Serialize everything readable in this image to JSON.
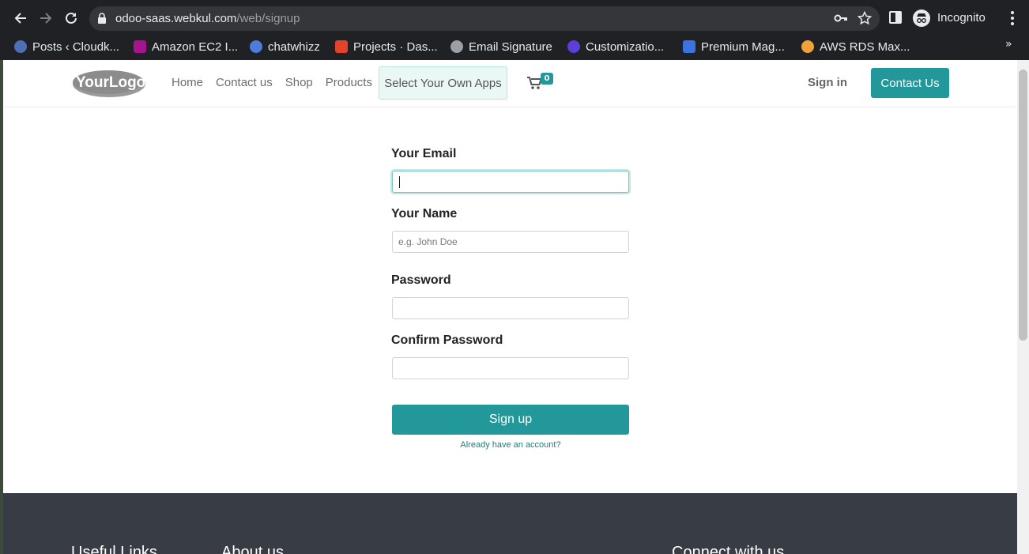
{
  "browser": {
    "url_host": "odoo-saas.webkul.com",
    "url_path": "/web/signup",
    "profile_label": "Incognito",
    "bookmarks": [
      {
        "label": "Posts ‹ Cloudk...",
        "color": "#4f6fb5"
      },
      {
        "label": "Amazon EC2 I...",
        "color": "#a4148f"
      },
      {
        "label": "chatwhizz",
        "color": "#4d7cd9"
      },
      {
        "label": "Projects · Das...",
        "color": "#e2432a"
      },
      {
        "label": "Email Signature",
        "color": "#9aa0a6"
      },
      {
        "label": "Customizatio...",
        "color": "#5b3fd6"
      },
      {
        "label": "Premium Mag...",
        "color": "#3b73e0"
      },
      {
        "label": "AWS RDS Max...",
        "color": "#f0a23a"
      }
    ],
    "more_symbol": "»"
  },
  "site": {
    "logo_text": "YourLogo",
    "nav": [
      "Home",
      "Contact us",
      "Shop",
      "Products"
    ],
    "apps_button": "Select Your Own Apps",
    "cart_count": "0",
    "sign_in": "Sign in",
    "contact_button": "Contact Us",
    "accent_color": "#23989a"
  },
  "form": {
    "email_label": "Your Email",
    "email_value": "",
    "name_label": "Your Name",
    "name_placeholder": "e.g. John Doe",
    "password_label": "Password",
    "confirm_label": "Confirm Password",
    "submit_label": "Sign up",
    "login_link": "Already have an account?"
  },
  "footer": {
    "col1": "Useful Links",
    "col2": "About us",
    "col3": "Connect with us"
  }
}
